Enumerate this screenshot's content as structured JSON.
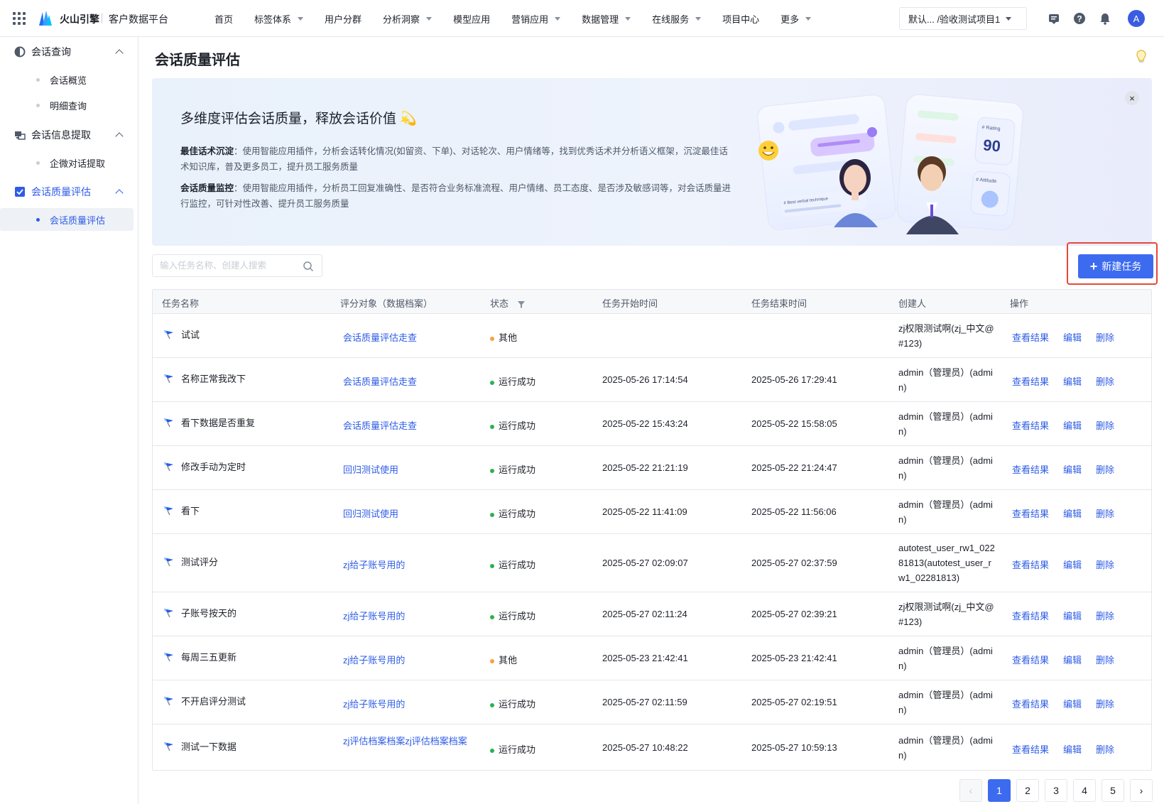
{
  "topbar": {
    "brand": "火山引擎",
    "product": "客户数据平台",
    "nav": [
      {
        "label": "首页",
        "has_caret": false
      },
      {
        "label": "标签体系",
        "has_caret": true
      },
      {
        "label": "用户分群",
        "has_caret": false
      },
      {
        "label": "分析洞察",
        "has_caret": true
      },
      {
        "label": "模型应用",
        "has_caret": false
      },
      {
        "label": "营销应用",
        "has_caret": true
      },
      {
        "label": "数据管理",
        "has_caret": true
      },
      {
        "label": "在线服务",
        "has_caret": true
      },
      {
        "label": "项目中心",
        "has_caret": false
      },
      {
        "label": "更多",
        "has_caret": true
      }
    ],
    "project_select": "默认... /验收测试项目1",
    "avatar": "A"
  },
  "sidebar": {
    "groups": [
      {
        "label": "会话查询",
        "items": [
          "会话概览",
          "明细查询"
        ]
      },
      {
        "label": "会话信息提取",
        "items": [
          "企微对话提取"
        ]
      },
      {
        "label": "会话质量评估",
        "items": [
          "会话质量评估"
        ],
        "active": true
      }
    ]
  },
  "page": {
    "title": "会话质量评估"
  },
  "banner": {
    "title": "多维度评估会话质量，释放会话价值 💫",
    "p1_label": "最佳话术沉淀",
    "p1_text": "：使用智能应用插件，分析会话转化情况(如留资、下单)、对话轮次、用户情绪等，找到优秀话术并分析语义框架，沉淀最佳话术知识库，普及更多员工，提升员工服务质量",
    "p2_label": "会话质量监控",
    "p2_text": "：使用智能应用插件，分析员工回复准确性、是否符合业务标准流程、用户情绪、员工态度、是否涉及敏感词等，对会话质量进行监控，可针对性改善、提升员工服务质量",
    "illus_rating_label": "# Rating",
    "illus_rating_value": "90",
    "illus_attitude_label": "# Attitude",
    "illus_verbal_label": "# Best verbal technique"
  },
  "toolbar": {
    "search_placeholder": "输入任务名称、创建人搜索",
    "new_button": "新建任务"
  },
  "table": {
    "headers": [
      "任务名称",
      "评分对象（数据档案）",
      "状态",
      "任务开始时间",
      "任务结束时间",
      "创建人",
      "操作"
    ],
    "actions": [
      "查看结果",
      "编辑",
      "删除"
    ],
    "rows": [
      {
        "name": "试试",
        "target": "会话质量评估走查",
        "status": "其他",
        "status_color": "#f7a23b",
        "start": "",
        "end": "",
        "creator": "zj权限测试啊(zj_中文@#123)"
      },
      {
        "name": "名称正常我改下",
        "target": "会话质量评估走查",
        "status": "运行成功",
        "status_color": "#2bb24c",
        "start": "2025-05-26 17:14:54",
        "end": "2025-05-26 17:29:41",
        "creator": "admin（管理员）(admin)"
      },
      {
        "name": "看下数据是否重复",
        "target": "会话质量评估走查",
        "status": "运行成功",
        "status_color": "#2bb24c",
        "start": "2025-05-22 15:43:24",
        "end": "2025-05-22 15:58:05",
        "creator": "admin（管理员）(admin)"
      },
      {
        "name": "修改手动为定时",
        "target": "回归测试使用",
        "status": "运行成功",
        "status_color": "#2bb24c",
        "start": "2025-05-22 21:21:19",
        "end": "2025-05-22 21:24:47",
        "creator": "admin（管理员）(admin)"
      },
      {
        "name": "看下",
        "target": "回归测试使用",
        "status": "运行成功",
        "status_color": "#2bb24c",
        "start": "2025-05-22 11:41:09",
        "end": "2025-05-22 11:56:06",
        "creator": "admin（管理员）(admin)"
      },
      {
        "name": "测试评分",
        "target": "zj给子账号用的",
        "status": "运行成功",
        "status_color": "#2bb24c",
        "start": "2025-05-27 02:09:07",
        "end": "2025-05-27 02:37:59",
        "creator": "autotest_user_rw1_02281813(autotest_user_rw1_02281813)"
      },
      {
        "name": "子账号按天的",
        "target": "zj给子账号用的",
        "status": "运行成功",
        "status_color": "#2bb24c",
        "start": "2025-05-27 02:11:24",
        "end": "2025-05-27 02:39:21",
        "creator": "zj权限测试啊(zj_中文@#123)"
      },
      {
        "name": "每周三五更新",
        "target": "zj给子账号用的",
        "status": "其他",
        "status_color": "#f7a23b",
        "start": "2025-05-23 21:42:41",
        "end": "2025-05-23 21:42:41",
        "creator": "admin（管理员）(admin)"
      },
      {
        "name": "不开启评分测试",
        "target": "zj给子账号用的",
        "status": "运行成功",
        "status_color": "#2bb24c",
        "start": "2025-05-27 02:11:59",
        "end": "2025-05-27 02:19:51",
        "creator": "admin（管理员）(admin)"
      },
      {
        "name": "测试一下数据",
        "target": "zj评估档案档案zj评估档案档案",
        "status": "运行成功",
        "status_color": "#2bb24c",
        "start": "2025-05-27 10:48:22",
        "end": "2025-05-27 10:59:13",
        "creator": "admin（管理员）(admin)"
      }
    ]
  },
  "pagination": {
    "pages": [
      "1",
      "2",
      "3",
      "4",
      "5"
    ],
    "current": "1",
    "prev": "‹",
    "next": "›"
  },
  "colors": {
    "primary": "#3d6bf0",
    "link": "#2e5ce6",
    "success": "#2bb24c",
    "warning": "#f7a23b",
    "highlight": "#e5483a"
  }
}
